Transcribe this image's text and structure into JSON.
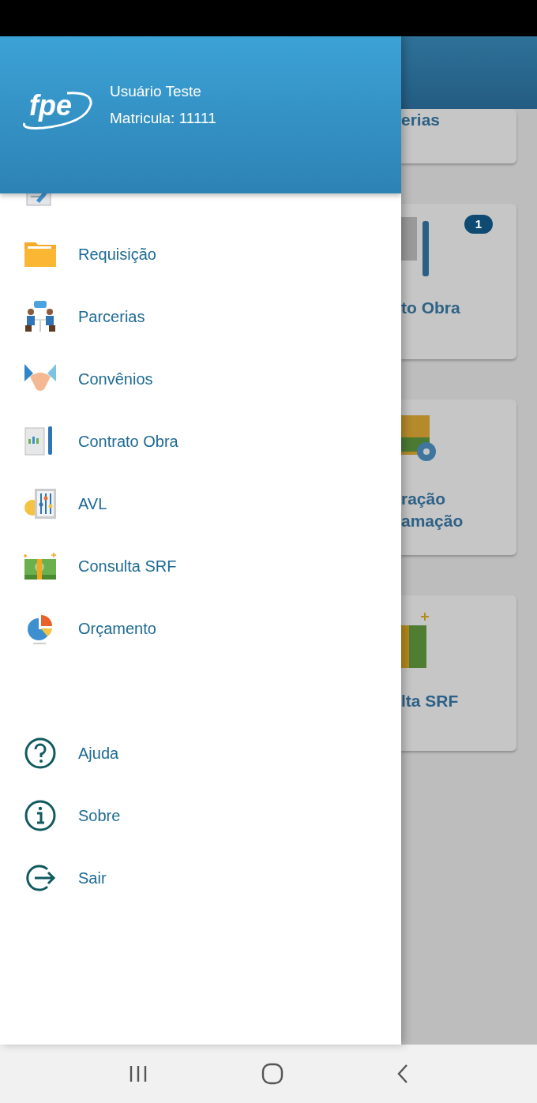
{
  "drawer": {
    "logo": "fpe",
    "user_name": "Usuário Teste",
    "user_id": "Matricula: 11111",
    "menu_items": [
      {
        "label": "Requisição"
      },
      {
        "label": "Parcerias"
      },
      {
        "label": "Convênios"
      },
      {
        "label": "Contrato Obra"
      },
      {
        "label": "AVL"
      },
      {
        "label": "Consulta SRF"
      },
      {
        "label": "Orçamento"
      }
    ],
    "footer_items": [
      {
        "label": "Ajuda"
      },
      {
        "label": "Sobre"
      },
      {
        "label": "Sair"
      }
    ]
  },
  "background": {
    "cards": [
      {
        "lines": [
          "erias"
        ]
      },
      {
        "lines": [
          "to Obra"
        ],
        "badge": "1"
      },
      {
        "lines": [
          "ração",
          "amação"
        ]
      },
      {
        "lines": [
          "lta SRF"
        ]
      }
    ]
  }
}
